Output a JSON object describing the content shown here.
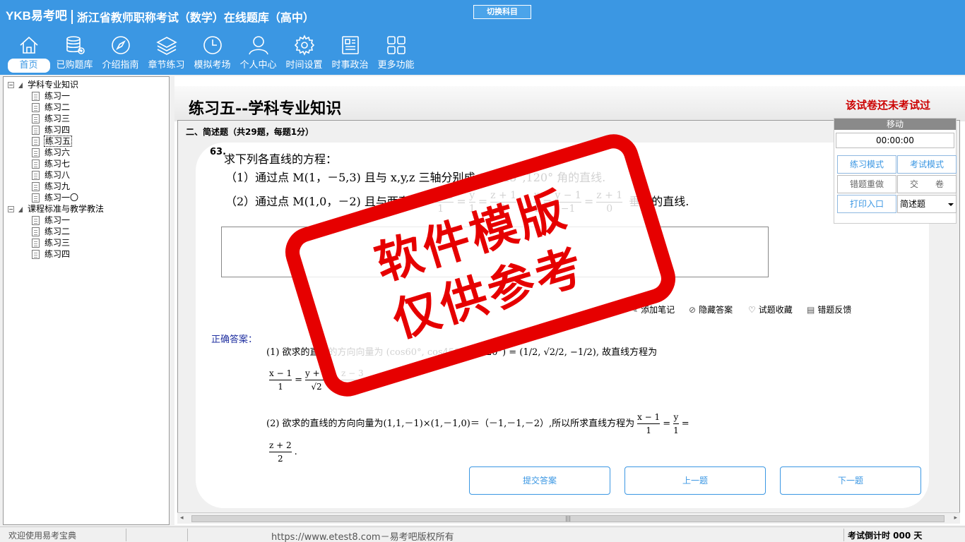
{
  "app": {
    "brand": "YKB易考吧",
    "title": "浙江省教师职称考试（数学）在线题库（高中）",
    "switch_label": "切换科目"
  },
  "nav": [
    {
      "label": "首页",
      "icon": "home-icon"
    },
    {
      "label": "已购题库",
      "icon": "database-icon"
    },
    {
      "label": "介绍指南",
      "icon": "compass-icon"
    },
    {
      "label": "章节练习",
      "icon": "layers-icon"
    },
    {
      "label": "模拟考场",
      "icon": "clock-icon"
    },
    {
      "label": "个人中心",
      "icon": "user-icon"
    },
    {
      "label": "时间设置",
      "icon": "gear-icon"
    },
    {
      "label": "时事政治",
      "icon": "news-icon"
    },
    {
      "label": "更多功能",
      "icon": "grid-icon"
    }
  ],
  "tree": {
    "group1": {
      "label": "学科专业知识",
      "items": [
        "练习一",
        "练习二",
        "练习三",
        "练习四",
        "练习五",
        "练习六",
        "练习七",
        "练习八",
        "练习九",
        "练习一〇"
      ]
    },
    "group2": {
      "label": "课程标准与教学教法",
      "items": [
        "练习一",
        "练习二",
        "练习三",
        "练习四"
      ]
    }
  },
  "main": {
    "paper_title": "练习五--学科专业知识",
    "not_taken": "该试卷还未考试过",
    "section_header": "二、简述题（共29题，每题1分）",
    "question_number": "63.",
    "question_intro": "求下列各直线的方程：",
    "question_part1": "（1）通过点 M(1，－5,3) 且与 x,y,z 三轴分别成 60°,45°,120° 角的直线.",
    "question_part2_start": "（2）通过点 M(1,0，－2) 且与两直线",
    "question_part2_end": "垂直的直线.",
    "actions": {
      "add_note": "添加笔记",
      "hide_answer": "隐藏答案",
      "favorite": "试题收藏",
      "feedback": "错题反馈"
    },
    "correct_label": "正确答案：",
    "solution1": "(1) 欲求的直线的方向向量为 (cos60°, cos45°, cos120°) = (1/2, √2/2, −1/2), 故直线方程为",
    "solution2": "(2) 欲求的直线的方向向量为(1,1,－1)×(1,－1,0)＝（－1,－1,－2）,所以所求直线方程为",
    "buttons": {
      "submit": "提交答案",
      "prev": "上一题",
      "next": "下一题"
    }
  },
  "panel": {
    "header": "移动",
    "timer": "00:00:00",
    "practice_mode": "练习模式",
    "exam_mode": "考试模式",
    "redo_wrong": "错题重做",
    "submit_paper": "交　　卷",
    "print": "打印入口",
    "question_type": "简述题"
  },
  "watermark": {
    "line1": "软件模版",
    "line2": "仅供参考"
  },
  "status": {
    "welcome": "欢迎使用易考宝典",
    "url": "https://www.etest8.com－易考吧版权所有",
    "countdown": "考试倒计时 000 天"
  }
}
